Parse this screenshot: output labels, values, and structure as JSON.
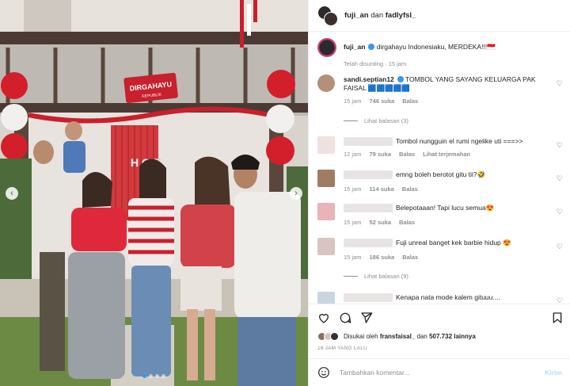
{
  "header": {
    "account1": "fuji_an",
    "joiner": "dan",
    "account2": "fadlyfsl_"
  },
  "caption": {
    "username": "fuji_an",
    "text": "dirgahayu Indonesiaku, MERDEKA!!!🇮🇩",
    "edited": "Telah disunting",
    "time": "15 jam"
  },
  "photo": {
    "banner_text": "DIRGAHAYU",
    "banner_subtext": "REPUBLIK"
  },
  "comments": [
    {
      "username": "sandi.septian12",
      "text": "TOMBOL YANG SAYANG KELUARGA PAK FAISAL 🟦🟦🟦🟦🟦",
      "time": "15 jam",
      "likes": "746 suka",
      "reply": "Balas",
      "view_replies": "Lihat balasan (3)"
    },
    {
      "username": "",
      "text": "Tombol nungguin el rumi ngelike uti ===>>",
      "time": "12 jam",
      "likes": "79 suka",
      "reply": "Balas",
      "translate": "Lihat terjemahan"
    },
    {
      "username": "",
      "text": "emng boleh berotot gitu tii?🤣",
      "time": "15 jam",
      "likes": "114 suka",
      "reply": "Balas"
    },
    {
      "username": "",
      "text": "Belepotaaan! Tapi lucu semua😍",
      "time": "15 jam",
      "likes": "52 suka",
      "reply": "Balas"
    },
    {
      "username": "",
      "text": "Fuji unreal banget kek barbie hidup 😍",
      "time": "15 jam",
      "likes": "186 suka",
      "reply": "Balas",
      "view_replies": "Lihat balasan (9)"
    },
    {
      "username": "",
      "text": "Kenapa nata mode kalem gituuu....",
      "time": "",
      "likes": "",
      "reply": ""
    }
  ],
  "likes": {
    "prefix": "Disukai oleh",
    "user": "fransfaisal_",
    "joiner": "dan",
    "count": "507.732 lainnya"
  },
  "timeago": "16 JAM YANG LALU",
  "composer": {
    "placeholder": "Tambahkan komentar...",
    "send": "Kirim"
  },
  "icons": [
    "heart-icon",
    "comment-icon",
    "share-icon",
    "bookmark-icon",
    "emoji-icon",
    "chevron-left-icon",
    "chevron-right-icon"
  ]
}
